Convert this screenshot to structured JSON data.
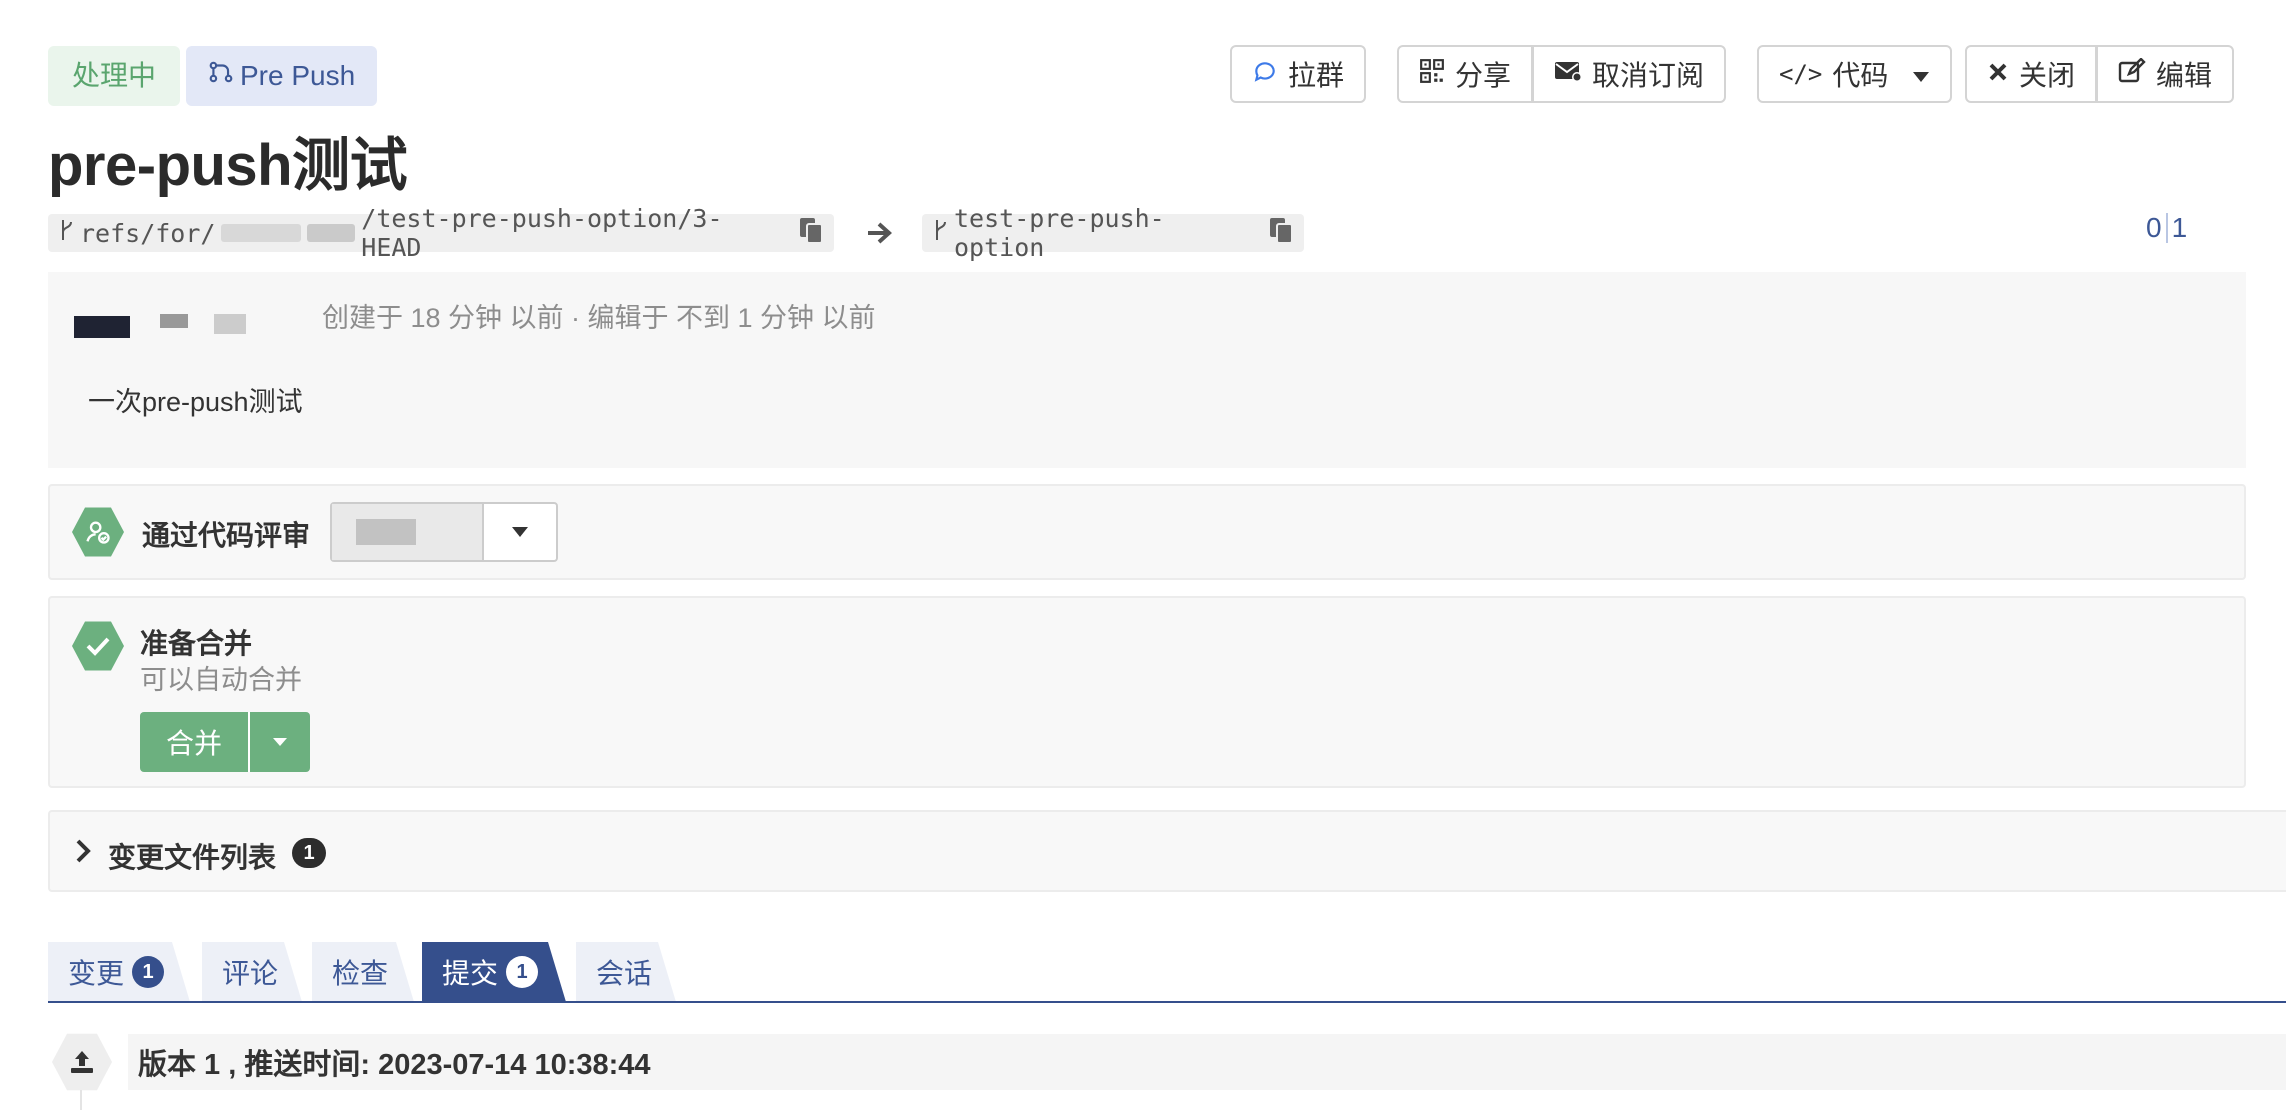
{
  "status_badge": "处理中",
  "type_badge": "Pre Push",
  "title": "pre-push测试",
  "toolbar": {
    "group_chat": "拉群",
    "share": "分享",
    "unsubscribe": "取消订阅",
    "code": "代码",
    "close": "关闭",
    "edit": "编辑"
  },
  "refs": {
    "source_prefix": "refs/for/",
    "source_suffix": "/test-pre-push-option/3-HEAD",
    "target": "test-pre-push-option"
  },
  "counter": {
    "left": "0",
    "right": "1"
  },
  "description": {
    "meta": "创建于 18 分钟 以前 · 编辑于 不到 1 分钟 以前",
    "body": "一次pre-push测试"
  },
  "review": {
    "label": "通过代码评审"
  },
  "merge": {
    "title": "准备合并",
    "subtitle": "可以自动合并",
    "button": "合并"
  },
  "changed_files": {
    "label": "变更文件列表",
    "count": "1"
  },
  "tabs": [
    {
      "label": "变更",
      "badge": "1"
    },
    {
      "label": "评论",
      "badge": ""
    },
    {
      "label": "检查",
      "badge": ""
    },
    {
      "label": "提交",
      "badge": "1"
    },
    {
      "label": "会话",
      "badge": ""
    }
  ],
  "version": {
    "text": "版本 1 , 推送时间: 2023-07-14 10:38:44"
  },
  "colors": {
    "accent": "#354f8c",
    "success": "#6cb07f",
    "status_text": "#5aa56e"
  }
}
